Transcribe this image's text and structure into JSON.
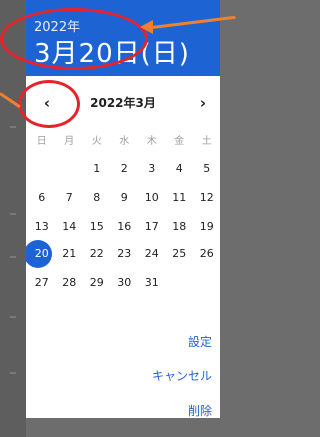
{
  "header": {
    "year": "2022年",
    "date": "3月20日(日)"
  },
  "calendar": {
    "month_label": "2022年3月",
    "prev_icon": "chevron-left-icon",
    "next_icon": "chevron-right-icon",
    "weekdays": [
      "日",
      "月",
      "火",
      "水",
      "木",
      "金",
      "土"
    ],
    "weeks": [
      [
        "",
        "",
        "1",
        "2",
        "3",
        "4",
        "5"
      ],
      [
        "6",
        "7",
        "8",
        "9",
        "10",
        "11",
        "12"
      ],
      [
        "13",
        "14",
        "15",
        "16",
        "17",
        "18",
        "19"
      ],
      [
        "20",
        "21",
        "22",
        "23",
        "24",
        "25",
        "26"
      ],
      [
        "27",
        "28",
        "29",
        "30",
        "31",
        "",
        ""
      ]
    ],
    "selected_day": "20"
  },
  "actions": {
    "set": "設定",
    "cancel": "キャンセル",
    "delete": "削除"
  },
  "colors": {
    "accent": "#1e63d4",
    "annotation_red": "#e6232b",
    "annotation_arrow": "#f08030"
  }
}
